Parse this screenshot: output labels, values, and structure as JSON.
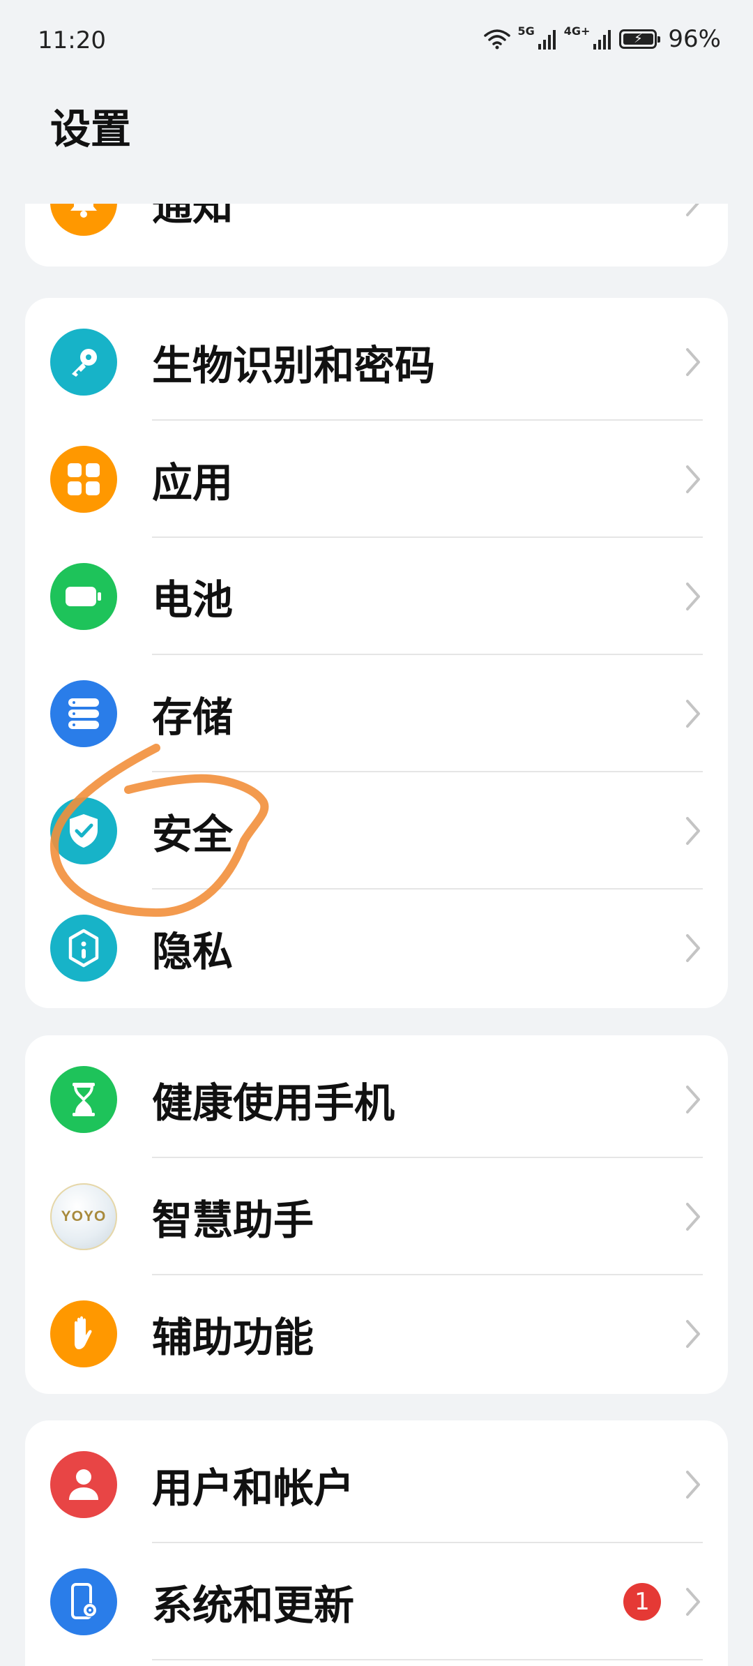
{
  "status": {
    "time": "11:20",
    "net1": "5G",
    "net2": "4G+",
    "battery": "96%"
  },
  "title": "设置",
  "colors": {
    "teal": "#17b3c8",
    "orange": "#ff9800",
    "green": "#1ec35a",
    "blue": "#2a7de9",
    "red": "#e84545",
    "annotation": "#f28f3b",
    "badge": "#e53935"
  },
  "groups": [
    {
      "items": [
        {
          "label": "通知",
          "icon": "bell-icon"
        }
      ]
    },
    {
      "items": [
        {
          "label": "生物识别和密码",
          "icon": "key-icon"
        },
        {
          "label": "应用",
          "icon": "apps-grid-icon"
        },
        {
          "label": "电池",
          "icon": "battery-icon"
        },
        {
          "label": "存储",
          "icon": "storage-icon"
        },
        {
          "label": "安全",
          "icon": "shield-check-icon"
        },
        {
          "label": "隐私",
          "icon": "privacy-lock-icon"
        }
      ]
    },
    {
      "items": [
        {
          "label": "健康使用手机",
          "icon": "hourglass-icon"
        },
        {
          "label": "智慧助手",
          "icon": "yoyo-icon",
          "icon_text": "YOYO"
        },
        {
          "label": "辅助功能",
          "icon": "hand-icon"
        }
      ]
    },
    {
      "items": [
        {
          "label": "用户和帐户",
          "icon": "user-icon"
        },
        {
          "label": "系统和更新",
          "icon": "phone-gear-icon",
          "badge": "1"
        }
      ]
    }
  ]
}
